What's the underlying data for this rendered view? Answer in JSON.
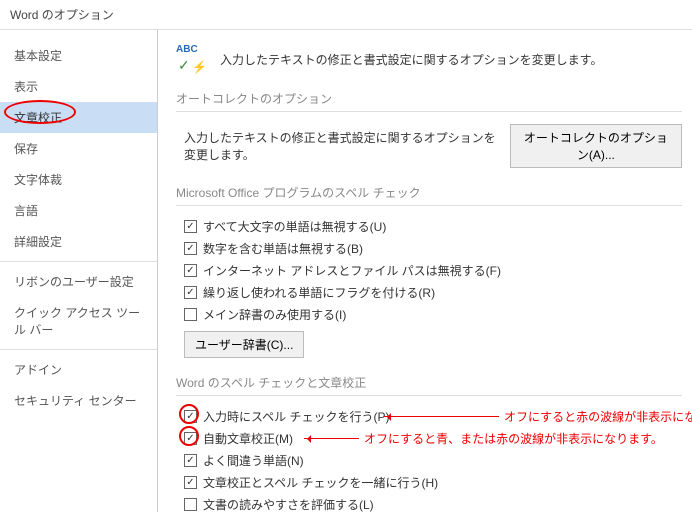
{
  "window": {
    "title": "Word のオプション"
  },
  "sidebar": {
    "items": [
      {
        "label": "基本設定"
      },
      {
        "label": "表示"
      },
      {
        "label": "文章校正",
        "selected": true
      },
      {
        "label": "保存"
      },
      {
        "label": "文字体裁"
      },
      {
        "label": "言語"
      },
      {
        "label": "詳細設定"
      }
    ],
    "items2": [
      {
        "label": "リボンのユーザー設定"
      },
      {
        "label": "クイック アクセス ツール バー"
      }
    ],
    "items3": [
      {
        "label": "アドイン"
      },
      {
        "label": "セキュリティ センター"
      }
    ]
  },
  "intro": {
    "text": "入力したテキストの修正と書式設定に関するオプションを変更します。"
  },
  "sections": {
    "autocorrect": {
      "header": "オートコレクトのオプション",
      "desc": "入力したテキストの修正と書式設定に関するオプションを変更します。",
      "button": "オートコレクトのオプション(A)..."
    },
    "msoffice_spell": {
      "header": "Microsoft Office プログラムのスペル チェック",
      "items": [
        {
          "checked": true,
          "label": "すべて大文字の単語は無視する(U)"
        },
        {
          "checked": true,
          "label": "数字を含む単語は無視する(B)"
        },
        {
          "checked": true,
          "label": "インターネット アドレスとファイル パスは無視する(F)"
        },
        {
          "checked": true,
          "label": "繰り返し使われる単語にフラグを付ける(R)"
        },
        {
          "checked": false,
          "label": "メイン辞書のみ使用する(I)"
        }
      ],
      "user_dict_btn": "ユーザー辞書(C)..."
    },
    "word_spell": {
      "header": "Word のスペル チェックと文章校正",
      "items": [
        {
          "checked": true,
          "label": "入力時にスペル チェックを行う(P)",
          "note": "オフにすると赤の波線が非表示になります。",
          "circle": true
        },
        {
          "checked": true,
          "label": "自動文章校正(M)",
          "note": "オフにすると青、または赤の波線が非表示になります。",
          "circle": true
        },
        {
          "checked": true,
          "label": "よく間違う単語(N)"
        },
        {
          "checked": true,
          "label": "文章校正とスペル チェックを一緒に行う(H)"
        },
        {
          "checked": false,
          "label": "文書の読みやすさを評価する(L)"
        }
      ]
    }
  }
}
